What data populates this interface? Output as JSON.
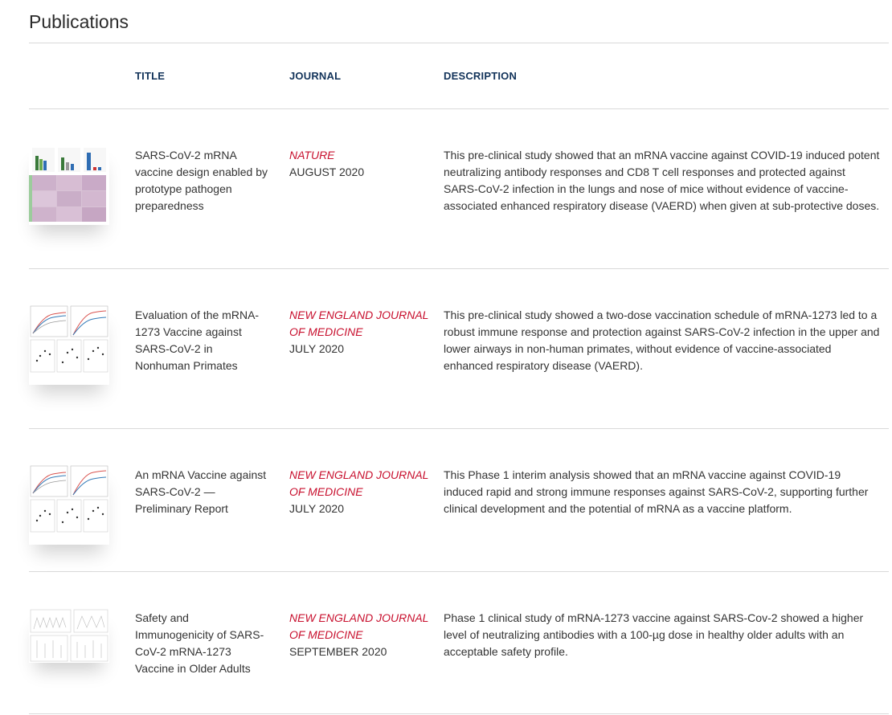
{
  "page": {
    "title": "Publications"
  },
  "table": {
    "headers": {
      "title": "TITLE",
      "journal": "JOURNAL",
      "description": "DESCRIPTION"
    },
    "rows": [
      {
        "thumbnail": "figure-thumbnail-heatmap",
        "title": "SARS-CoV-2 mRNA vaccine design enabled by prototype pathogen preparedness",
        "journal": "NATURE",
        "date": "AUGUST 2020",
        "description": "This pre-clinical study showed that an mRNA vaccine against COVID-19 induced potent neutralizing antibody responses and CD8 T cell responses and protected against SARS-CoV-2 infection in the lungs and nose of mice without evidence of vaccine-associated enhanced respiratory disease (VAERD) when given at sub-protective doses."
      },
      {
        "thumbnail": "figure-thumbnail-curves",
        "title": "Evaluation of the mRNA-1273 Vaccine against SARS-CoV-2 in Nonhuman Primates",
        "journal": "NEW ENGLAND JOURNAL OF MEDICINE",
        "date": "JULY 2020",
        "description": "This pre-clinical study showed a two-dose vaccination schedule of mRNA-1273 led to a robust immune response and protection against SARS-CoV-2 infection in the upper and lower airways in non-human primates, without evidence of vaccine-associated enhanced respiratory disease (VAERD)."
      },
      {
        "thumbnail": "figure-thumbnail-curves",
        "title": "An mRNA Vaccine against SARS-CoV-2 — Preliminary Report",
        "journal": "NEW ENGLAND JOURNAL OF MEDICINE",
        "date": "JULY 2020",
        "description": "This Phase 1 interim analysis showed that an mRNA vaccine against COVID-19 induced rapid and strong immune responses against SARS-CoV-2, supporting further clinical development and the potential of mRNA as a vaccine platform."
      },
      {
        "thumbnail": "figure-thumbnail-panels",
        "title": "Safety and Immunogenicity of SARS-CoV-2 mRNA-1273 Vaccine in Older Adults",
        "journal": "NEW ENGLAND JOURNAL OF MEDICINE",
        "date": "SEPTEMBER 2020",
        "description": "Phase 1 clinical study of mRNA-1273 vaccine against SARS-Cov-2 showed a higher level of neutralizing antibodies with a 100-µg dose in healthy older adults with an acceptable safety profile."
      }
    ]
  },
  "colors": {
    "header_text": "#12335a",
    "journal_name": "#c8102e",
    "divider": "#d9d9d9"
  }
}
